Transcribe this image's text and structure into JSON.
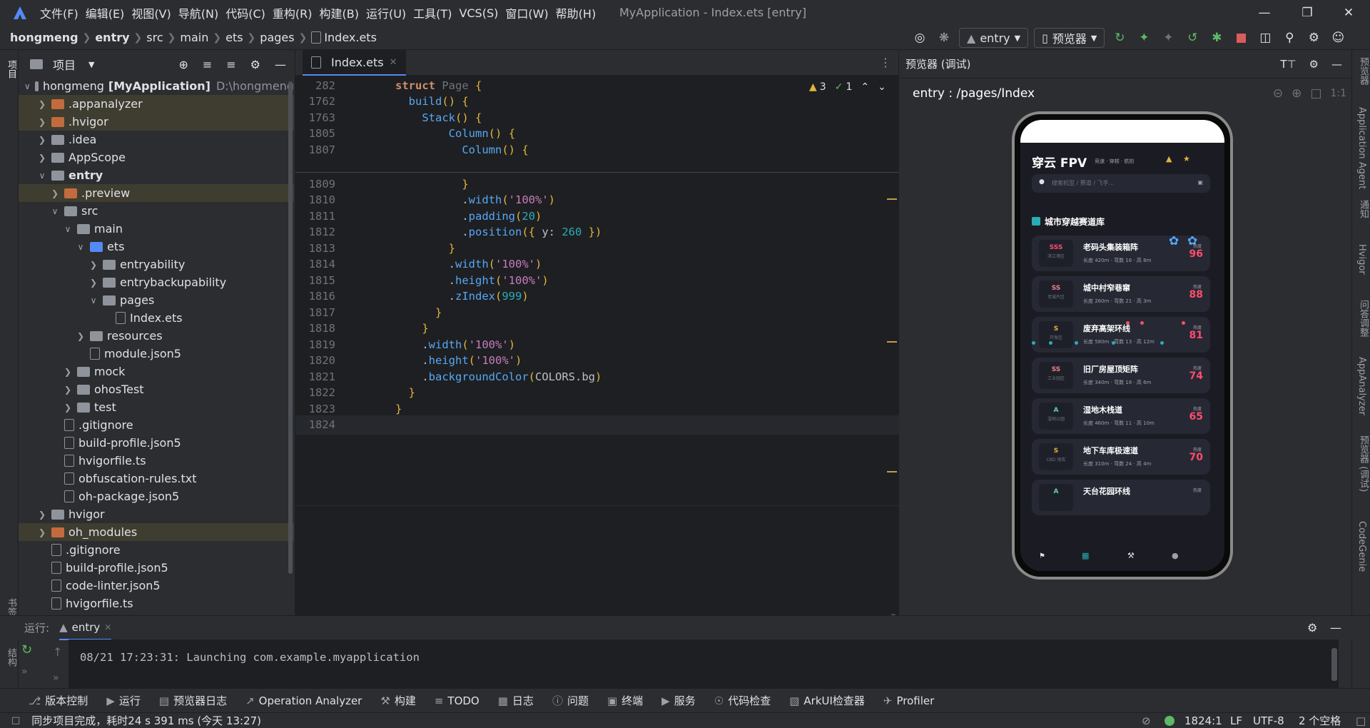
{
  "window": {
    "title": "MyApplication - Index.ets [entry]"
  },
  "menu": [
    "文件(F)",
    "编辑(E)",
    "视图(V)",
    "导航(N)",
    "代码(C)",
    "重构(R)",
    "构建(B)",
    "运行(U)",
    "工具(T)",
    "VCS(S)",
    "窗口(W)",
    "帮助(H)"
  ],
  "breadcrumb": [
    "hongmeng",
    "entry",
    "src",
    "main",
    "ets",
    "pages",
    "Index.ets"
  ],
  "toolbar": {
    "run_config": "entry",
    "device": "预览器"
  },
  "project": {
    "title": "项目",
    "root_name": "hongmeng",
    "root_module": "[MyApplication]",
    "root_path": "D:\\hongmeng",
    "items": [
      {
        "label": "hongmeng [MyApplication]",
        "depth": 0,
        "kind": "root",
        "open": true
      },
      {
        "label": ".appanalyzer",
        "depth": 1,
        "kind": "orange",
        "open": false
      },
      {
        "label": ".hvigor",
        "depth": 1,
        "kind": "orange",
        "open": false
      },
      {
        "label": ".idea",
        "depth": 1,
        "kind": "grey",
        "open": false
      },
      {
        "label": "AppScope",
        "depth": 1,
        "kind": "grey",
        "open": false
      },
      {
        "label": "entry",
        "depth": 1,
        "kind": "grey",
        "open": true
      },
      {
        "label": ".preview",
        "depth": 2,
        "kind": "orange",
        "open": false
      },
      {
        "label": "src",
        "depth": 2,
        "kind": "grey",
        "open": true
      },
      {
        "label": "main",
        "depth": 3,
        "kind": "grey",
        "open": true
      },
      {
        "label": "ets",
        "depth": 4,
        "kind": "blue",
        "open": true
      },
      {
        "label": "entryability",
        "depth": 5,
        "kind": "grey",
        "open": false
      },
      {
        "label": "entrybackupability",
        "depth": 5,
        "kind": "grey",
        "open": false
      },
      {
        "label": "pages",
        "depth": 5,
        "kind": "grey",
        "open": true
      },
      {
        "label": "Index.ets",
        "depth": 6,
        "kind": "file"
      },
      {
        "label": "resources",
        "depth": 4,
        "kind": "grey",
        "open": false
      },
      {
        "label": "module.json5",
        "depth": 4,
        "kind": "file"
      },
      {
        "label": "mock",
        "depth": 3,
        "kind": "grey",
        "open": false
      },
      {
        "label": "ohosTest",
        "depth": 3,
        "kind": "grey",
        "open": false
      },
      {
        "label": "test",
        "depth": 3,
        "kind": "grey",
        "open": false
      },
      {
        "label": ".gitignore",
        "depth": 2,
        "kind": "file"
      },
      {
        "label": "build-profile.json5",
        "depth": 2,
        "kind": "file"
      },
      {
        "label": "hvigorfile.ts",
        "depth": 2,
        "kind": "file"
      },
      {
        "label": "obfuscation-rules.txt",
        "depth": 2,
        "kind": "file"
      },
      {
        "label": "oh-package.json5",
        "depth": 2,
        "kind": "file"
      },
      {
        "label": "hvigor",
        "depth": 1,
        "kind": "grey",
        "open": false
      },
      {
        "label": "oh_modules",
        "depth": 1,
        "kind": "orange",
        "open": false
      },
      {
        "label": ".gitignore",
        "depth": 1,
        "kind": "file"
      },
      {
        "label": "build-profile.json5",
        "depth": 1,
        "kind": "file"
      },
      {
        "label": "code-linter.json5",
        "depth": 1,
        "kind": "file"
      },
      {
        "label": "hvigorfile.ts",
        "depth": 1,
        "kind": "file"
      }
    ]
  },
  "editor": {
    "tab": "Index.ets",
    "warnings": "3",
    "checks": "1",
    "sticky": [
      {
        "n": "282",
        "t": "struct Page {"
      },
      {
        "n": "1762",
        "t": "  build() {"
      },
      {
        "n": "1763",
        "t": "    Stack() {"
      },
      {
        "n": "1805",
        "t": "        Column() {"
      },
      {
        "n": "1807",
        "t": "          Column() {"
      }
    ],
    "lines": [
      {
        "n": "1809",
        "t": "          }"
      },
      {
        "n": "1810",
        "t": "          .width('100%')"
      },
      {
        "n": "1811",
        "t": "          .padding(20)"
      },
      {
        "n": "1812",
        "t": "          .position({ y: 260 })"
      },
      {
        "n": "1813",
        "t": "        }"
      },
      {
        "n": "1814",
        "t": "        .width('100%')"
      },
      {
        "n": "1815",
        "t": "        .height('100%')"
      },
      {
        "n": "1816",
        "t": "        .zIndex(999)"
      },
      {
        "n": "1817",
        "t": "      }"
      },
      {
        "n": "1818",
        "t": "    }"
      },
      {
        "n": "1819",
        "t": "    .width('100%')"
      },
      {
        "n": "1820",
        "t": "    .height('100%')"
      },
      {
        "n": "1821",
        "t": "    .backgroundColor(COLORS.bg)"
      },
      {
        "n": "1822",
        "t": "  }"
      },
      {
        "n": "1823",
        "t": "}"
      },
      {
        "n": "1824",
        "t": ""
      }
    ]
  },
  "preview": {
    "title": "预览器 (调试)",
    "route": "entry : /pages/Index",
    "app": {
      "title": "穿云 FPV",
      "subtitle": "竞速 · 穿越 · 航拍",
      "search_placeholder": "搜索机型 / 赛道 / 飞手...",
      "section": "城市穿越赛道库",
      "cards": [
        {
          "grade": "SSS",
          "area": "滨江港区",
          "name": "老码头集装箱阵",
          "meta": "长度 420m · 弯数 16 · 高 8m",
          "heat_label": "热度",
          "heat": "96"
        },
        {
          "grade": "SS",
          "area": "老城片区",
          "name": "城中村窄巷窜",
          "meta": "长度 260m · 弯数 21 · 高 3m",
          "heat_label": "热度",
          "heat": "88"
        },
        {
          "grade": "S",
          "area": "开发区",
          "name": "废弃高架环线",
          "meta": "长度 580m · 弯数 13 · 高 12m",
          "heat_label": "热度",
          "heat": "81"
        },
        {
          "grade": "SS",
          "area": "工业园区",
          "name": "旧厂房屋顶矩阵",
          "meta": "长度 340m · 弯数 18 · 高 6m",
          "heat_label": "热度",
          "heat": "74"
        },
        {
          "grade": "A",
          "area": "湿地公园",
          "name": "湿地木栈道",
          "meta": "长度 460m · 弯数 11 · 高 10m",
          "heat_label": "热度",
          "heat": "65"
        },
        {
          "grade": "S",
          "area": "CBD 地库",
          "name": "地下车库极速道",
          "meta": "长度 310m · 弯数 24 · 高 4m",
          "heat_label": "热度",
          "heat": "70"
        },
        {
          "grade": "A",
          "area": "",
          "name": "天台花园环线",
          "meta": "",
          "heat_label": "热度",
          "heat": ""
        }
      ]
    }
  },
  "run": {
    "label": "运行:",
    "config": "entry",
    "console": "08/21 17:23:31: Launching com.example.myapplication"
  },
  "bottom_tabs": [
    "版本控制",
    "运行",
    "预览器日志",
    "Operation Analyzer",
    "构建",
    "TODO",
    "日志",
    "问题",
    "终端",
    "服务",
    "代码检查",
    "ArkUI检查器",
    "Profiler"
  ],
  "left_strip": [
    "项目",
    "书签",
    "结构"
  ],
  "right_strip": [
    "预览器",
    "Application Agent",
    "通知",
    "Hvigor",
    "问答调整",
    "AppAnalyzer",
    "预览器 (调试)",
    "CodeGenie"
  ],
  "status": {
    "message": "同步项目完成，耗时24 s 391 ms (今天 13:27)",
    "position": "1824:1",
    "line_ending": "LF",
    "encoding": "UTF-8",
    "indent": "2 个空格"
  },
  "colors": {
    "accent": "#548af7",
    "bg": "#2b2d30",
    "editor_bg": "#1e1f22",
    "heat": "#ff4d6d"
  }
}
